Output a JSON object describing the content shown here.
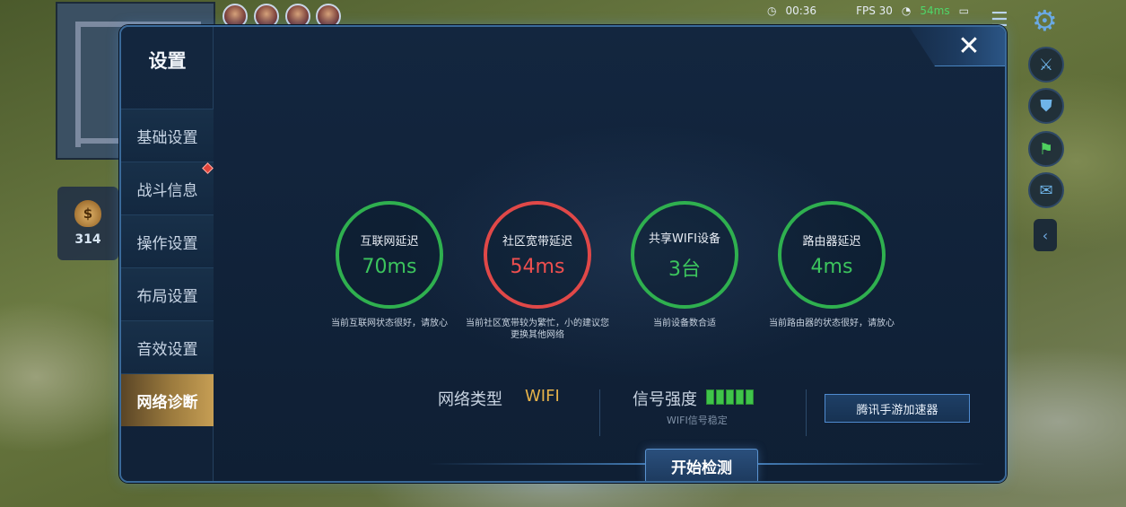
{
  "hud": {
    "timer": "00:36",
    "fps": "FPS 30",
    "ping": "54ms",
    "gold": "314",
    "gold_icon": "$"
  },
  "dialog": {
    "title": "设置",
    "close_label": "✕",
    "nav": [
      {
        "label": "基础设置",
        "active": false,
        "badge": false
      },
      {
        "label": "战斗信息",
        "active": false,
        "badge": true
      },
      {
        "label": "操作设置",
        "active": false,
        "badge": false
      },
      {
        "label": "布局设置",
        "active": false,
        "badge": false
      },
      {
        "label": "音效设置",
        "active": false,
        "badge": false
      },
      {
        "label": "网络诊断",
        "active": true,
        "badge": false
      }
    ]
  },
  "metrics": [
    {
      "label": "互联网延迟",
      "value": "70ms",
      "status": "good",
      "desc": "当前互联网状态很好，请放心"
    },
    {
      "label": "社区宽带延迟",
      "value": "54ms",
      "status": "bad",
      "desc": "当前社区宽带较为繁忙，小的建议您更换其他网络"
    },
    {
      "label": "共享WIFI设备",
      "value": "3台",
      "status": "good",
      "desc": "当前设备数合适"
    },
    {
      "label": "路由器延迟",
      "value": "4ms",
      "status": "good",
      "desc": "当前路由器的状态很好，请放心"
    }
  ],
  "network": {
    "type_label": "网络类型",
    "type_value": "WIFI",
    "signal_label": "信号强度",
    "signal_bars_filled": 5,
    "signal_bars_total": 5,
    "signal_status": "WIFI信号稳定"
  },
  "buttons": {
    "accelerator": "腾讯手游加速器",
    "start": "开始检测"
  },
  "colors": {
    "good": "#2fb04f",
    "bad": "#e04848",
    "active_tab": "#c69e54",
    "wifi_value": "#e8b34a"
  }
}
